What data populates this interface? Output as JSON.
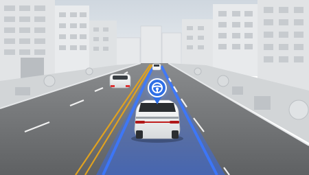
{
  "scene": {
    "type": "autonomous-driving-visualization",
    "palette": {
      "sky": "#dde3e9",
      "road": "#6f7173",
      "sidewalk": "#cfd2d4",
      "building": "#e4e6e8",
      "lane_white": "#f2f2f2",
      "center_yellow": "#e0a220",
      "path_blue": "#2f6bff",
      "path_blue_glow": "#5d8cff",
      "car_white": "#f2f3f4",
      "car_dark": "#2b2e31",
      "marker_blue": "#2f6fe6"
    },
    "marker": {
      "icon": "steering-wheel-icon"
    },
    "vehicles": [
      {
        "name": "ego-vehicle",
        "role": "autonomous"
      },
      {
        "name": "lead-vehicle-left",
        "role": "traffic"
      },
      {
        "name": "lead-vehicle-far",
        "role": "traffic"
      }
    ]
  }
}
